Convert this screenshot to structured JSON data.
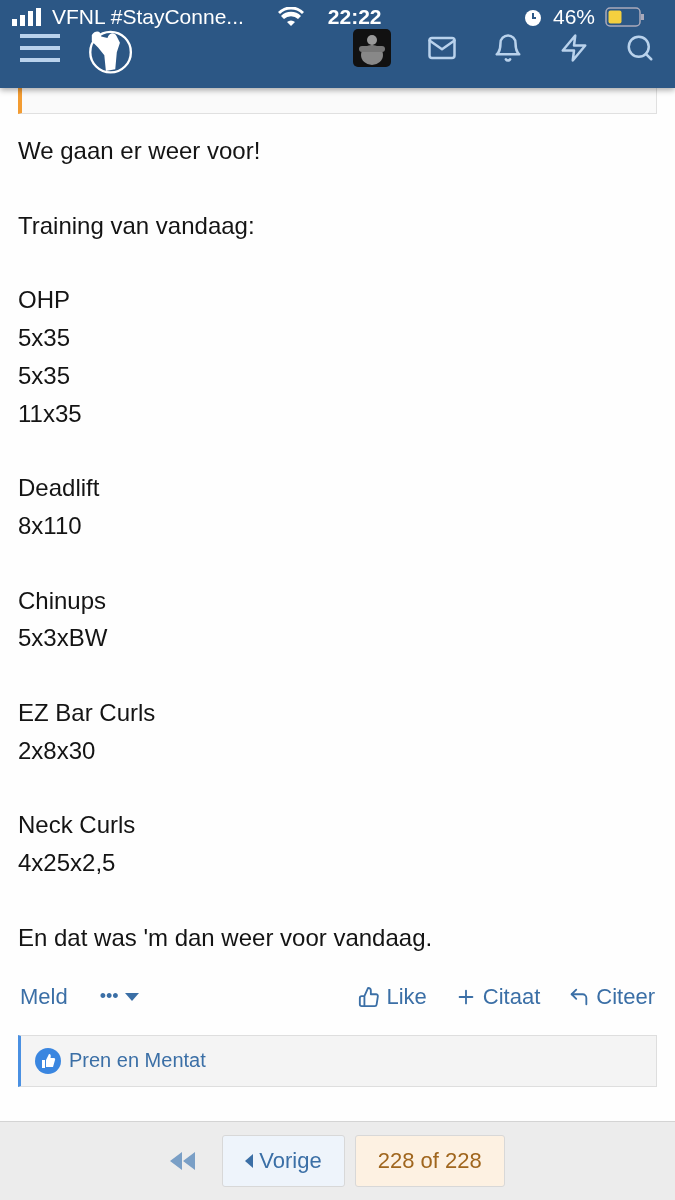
{
  "status_bar": {
    "carrier": "VFNL #StayConne...",
    "time": "22:22",
    "battery": "46%"
  },
  "quote": {
    "kind": "partial"
  },
  "post": {
    "paragraphs": [
      [
        "We gaan er weer voor!"
      ],
      [
        "Training van vandaag:"
      ],
      [
        "OHP",
        "5x35",
        "5x35",
        "11x35"
      ],
      [
        "Deadlift",
        "8x110"
      ],
      [
        "Chinups",
        "5x3xBW"
      ],
      [
        "EZ Bar Curls",
        "2x8x30"
      ],
      [
        "Neck Curls",
        "4x25x2,5"
      ],
      [
        "En dat was 'm dan weer voor vandaag."
      ]
    ]
  },
  "actions": {
    "report": "Meld",
    "more": "•••",
    "buttons": [
      {
        "kind": "like",
        "label": "Like"
      },
      {
        "kind": "quote",
        "label": "Citaat"
      },
      {
        "kind": "reply",
        "label": "Citeer"
      }
    ]
  },
  "reactions": {
    "names": "Pren en Mentat"
  },
  "pagination": {
    "previous": "Vorige",
    "current": "228 of 228"
  }
}
